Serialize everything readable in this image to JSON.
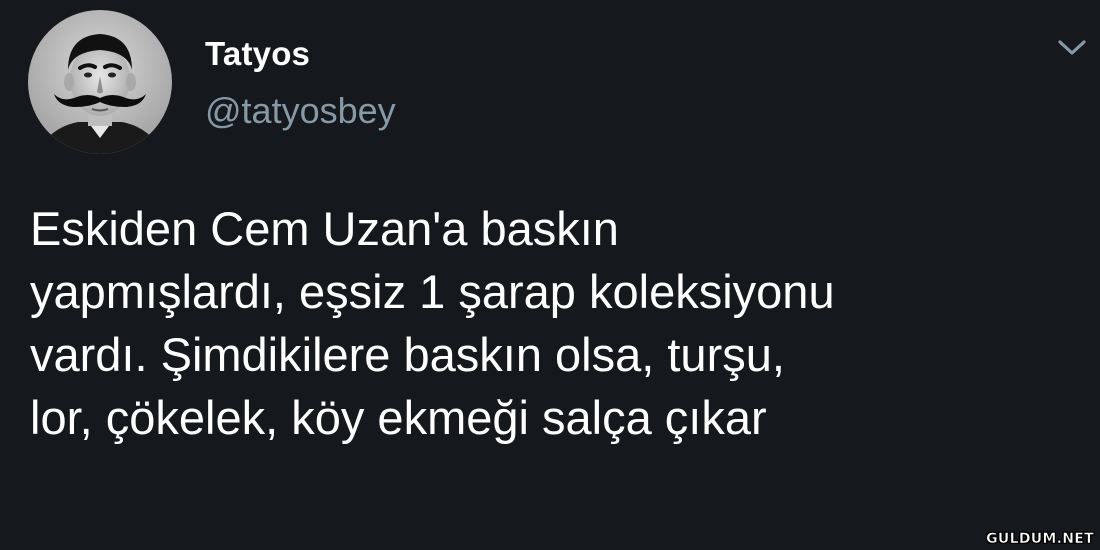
{
  "tweet": {
    "author": {
      "display_name": "Tatyos",
      "username": "@tatyosbey",
      "avatar_icon": "portrait-avatar-icon"
    },
    "menu_icon": "chevron-down-icon",
    "text_lines": [
      "Eskiden Cem Uzan'a baskın",
      "yapmışlardı, eşsiz 1 şarap koleksiyonu",
      "vardı. Şimdikilere baskın olsa, turşu,",
      "lor, çökelek, köy ekmeği salça çıkar"
    ]
  },
  "watermark": "GULDUM.NET",
  "colors": {
    "background": "#15181d",
    "primary_text": "#ffffff",
    "secondary_text": "#8899a6"
  }
}
